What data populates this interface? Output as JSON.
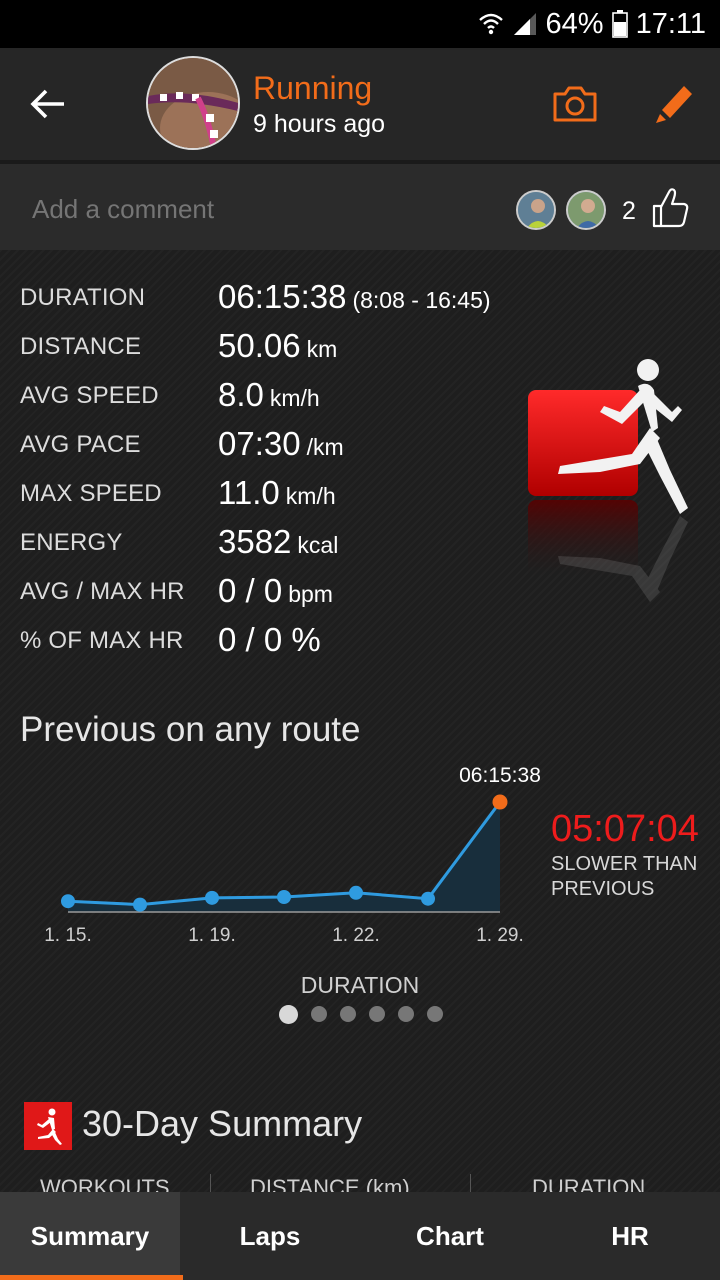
{
  "status_bar": {
    "battery": "64%",
    "time": "17:11"
  },
  "header": {
    "title": "Running",
    "subtitle": "9 hours ago"
  },
  "comment": {
    "placeholder": "Add a comment",
    "like_count": "2"
  },
  "stats": [
    {
      "label": "DURATION",
      "value": "06:15:38",
      "unit": "(8:08 - 16:45)"
    },
    {
      "label": "DISTANCE",
      "value": "50.06",
      "unit": "km"
    },
    {
      "label": "AVG SPEED",
      "value": "8.0",
      "unit": "km/h"
    },
    {
      "label": "AVG PACE",
      "value": "07:30",
      "unit": "/km"
    },
    {
      "label": "MAX SPEED",
      "value": "11.0",
      "unit": "km/h"
    },
    {
      "label": "ENERGY",
      "value": "3582",
      "unit": "kcal"
    },
    {
      "label": "AVG / MAX HR",
      "value": "0 / 0",
      "unit": "bpm"
    },
    {
      "label": "% OF MAX HR",
      "value": "0 / 0 %",
      "unit": ""
    }
  ],
  "previous": {
    "title": "Previous on any route",
    "difference": "05:07:04",
    "caption": "SLOWER THAN PREVIOUS",
    "chart_label": "DURATION",
    "pages": 6,
    "active_page": 0
  },
  "chart_data": {
    "type": "line",
    "title": "",
    "xlabel": "",
    "ylabel": "",
    "x_ticks": [
      "1. 15.",
      "1. 19.",
      "1. 22.",
      "1. 29."
    ],
    "tick_point_indices": [
      0,
      2,
      4,
      6
    ],
    "values_hours": [
      0.4,
      0.2,
      0.6,
      0.65,
      0.9,
      0.55,
      6.2606
    ],
    "highlight_index": 6,
    "highlight_label": "06:15:38",
    "ylim": [
      0,
      6.5
    ],
    "colors": {
      "line": "#2f9be0",
      "fill": "#17303f",
      "highlight": "#f26c1a"
    }
  },
  "summary": {
    "title": "30-Day Summary",
    "columns": [
      "WORKOUTS",
      "DISTANCE (km)",
      "DURATION"
    ]
  },
  "tabs": [
    {
      "label": "Summary",
      "active": true
    },
    {
      "label": "Laps",
      "active": false
    },
    {
      "label": "Chart",
      "active": false
    },
    {
      "label": "HR",
      "active": false
    }
  ]
}
